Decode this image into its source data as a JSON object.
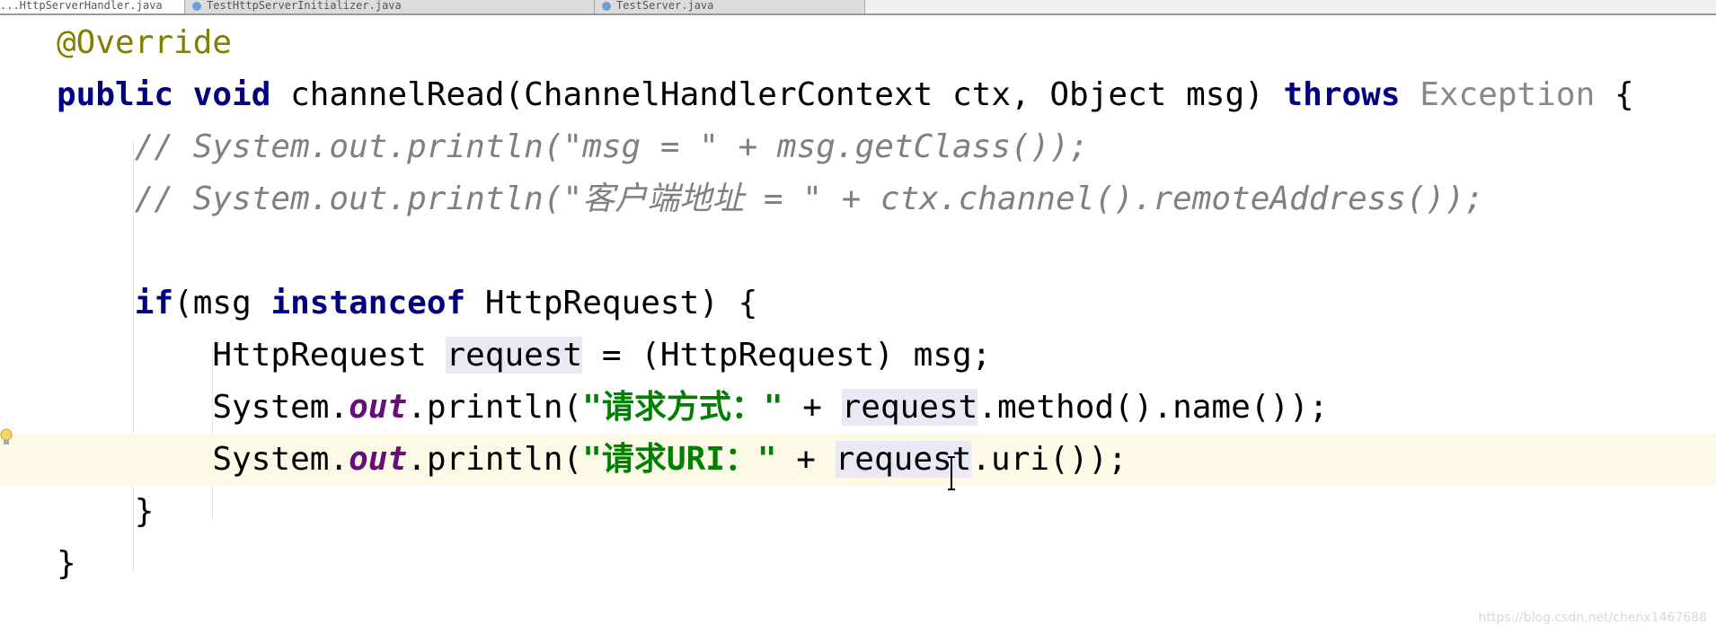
{
  "tabs": [
    {
      "label": "...HttpServerHandler.java",
      "active": true
    },
    {
      "label": "TestHttpServerInitializer.java",
      "active": false
    },
    {
      "label": "TestServer.java",
      "active": false
    }
  ],
  "code": {
    "current_line": 8,
    "lines": [
      [
        {
          "t": "@Override",
          "c": "ann"
        }
      ],
      [
        {
          "t": "public void ",
          "c": "kw"
        },
        {
          "t": "channelRead(ChannelHandlerContext ctx, Object msg) "
        },
        {
          "t": "throws ",
          "c": "kw"
        },
        {
          "t": "Exception",
          "c": "gray"
        },
        {
          "t": " {"
        }
      ],
      [
        {
          "t": "    // System.out.println(\"msg = \" + msg.getClass());",
          "c": "cm"
        }
      ],
      [
        {
          "t": "    // System.out.println(\"客户端地址 = \" + ctx.channel().remoteAddress());",
          "c": "cm"
        }
      ],
      [],
      [
        {
          "t": "    "
        },
        {
          "t": "if",
          "c": "kw"
        },
        {
          "t": "(msg "
        },
        {
          "t": "instanceof ",
          "c": "kw"
        },
        {
          "t": "HttpRequest) {"
        }
      ],
      [
        {
          "t": "        HttpRequest "
        },
        {
          "t": "request",
          "c": "hl"
        },
        {
          "t": " = (HttpRequest) msg;"
        }
      ],
      [
        {
          "t": "        System."
        },
        {
          "t": "out",
          "c": "st"
        },
        {
          "t": ".println("
        },
        {
          "t": "\"请求方式：\"",
          "c": "str"
        },
        {
          "t": " + "
        },
        {
          "t": "request",
          "c": "hl"
        },
        {
          "t": ".method().name());"
        }
      ],
      [
        {
          "t": "        System."
        },
        {
          "t": "out",
          "c": "st"
        },
        {
          "t": ".println("
        },
        {
          "t": "\"请求URI：\"",
          "c": "str"
        },
        {
          "t": " + "
        },
        {
          "t": "request",
          "c": "hl"
        },
        {
          "t": ".uri());"
        }
      ],
      [
        {
          "t": "    }"
        }
      ],
      [
        {
          "t": "}"
        }
      ]
    ]
  },
  "watermark": "https://blog.csdn.net/chenx1467688"
}
